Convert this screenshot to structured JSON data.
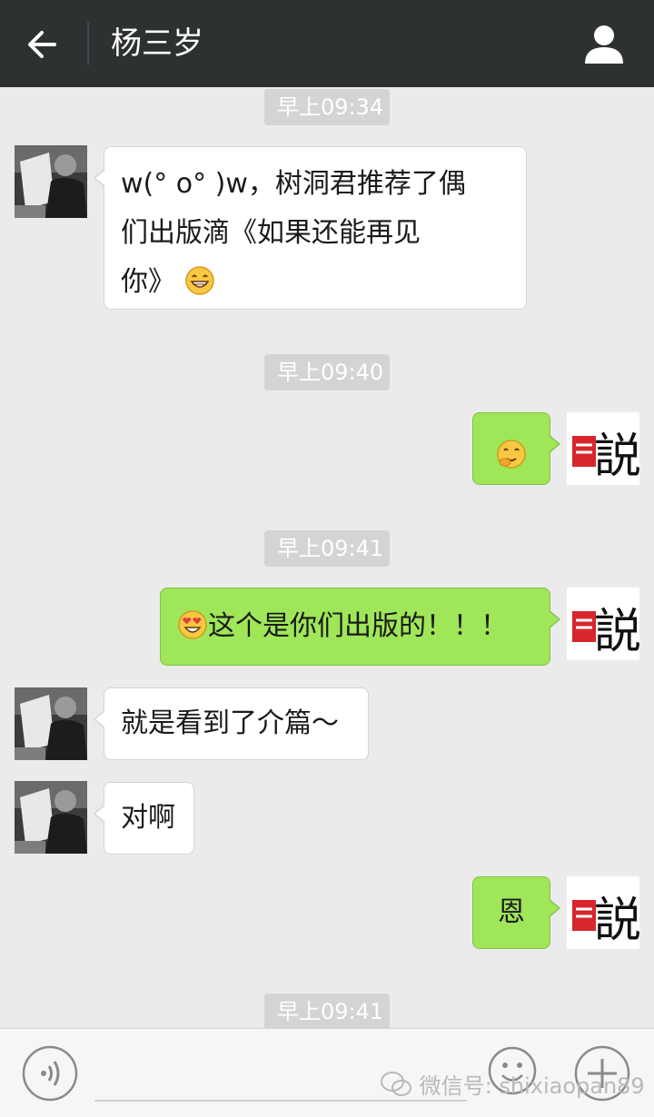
{
  "header": {
    "title": "杨三岁",
    "back_icon": "back-arrow-icon",
    "contact_icon": "person-icon"
  },
  "messages": [
    {
      "type": "time",
      "text": "早上09:34"
    },
    {
      "type": "in",
      "text": "w(° o° )w，树洞君推荐了偶们出版滴《如果还能再见你》",
      "emoji": "grin-emoji"
    },
    {
      "type": "time",
      "text": "早上09:40"
    },
    {
      "type": "out",
      "text": "",
      "emoji": "chuckle-emoji"
    },
    {
      "type": "time",
      "text": "早上09:41"
    },
    {
      "type": "out",
      "text": "这个是你们出版的！！！",
      "emoji": "heart-eyes-emoji"
    },
    {
      "type": "in",
      "text": "就是看到了介篇～"
    },
    {
      "type": "in",
      "text": "对啊"
    },
    {
      "type": "out",
      "text": "恩"
    },
    {
      "type": "time",
      "text": "早上09:41"
    }
  ],
  "bubble_lines": {
    "m1_line1": "w(°  o° )w，树洞君推荐了偶",
    "m1_line2": "们出版滴《如果还能再见",
    "m1_line3": "你》"
  },
  "avatars": {
    "self_logo_text": "説",
    "contact_avatar": "photo-avatar"
  },
  "footer": {
    "watermark": "微信号: shixiaopan89"
  },
  "colors": {
    "topbar": "#2e3132",
    "background": "#ebebeb",
    "outgoing_bubble": "#9fe658",
    "incoming_bubble": "#ffffff",
    "timestamp_bg": "#d4d4d4",
    "logo_red": "#d7262c"
  }
}
